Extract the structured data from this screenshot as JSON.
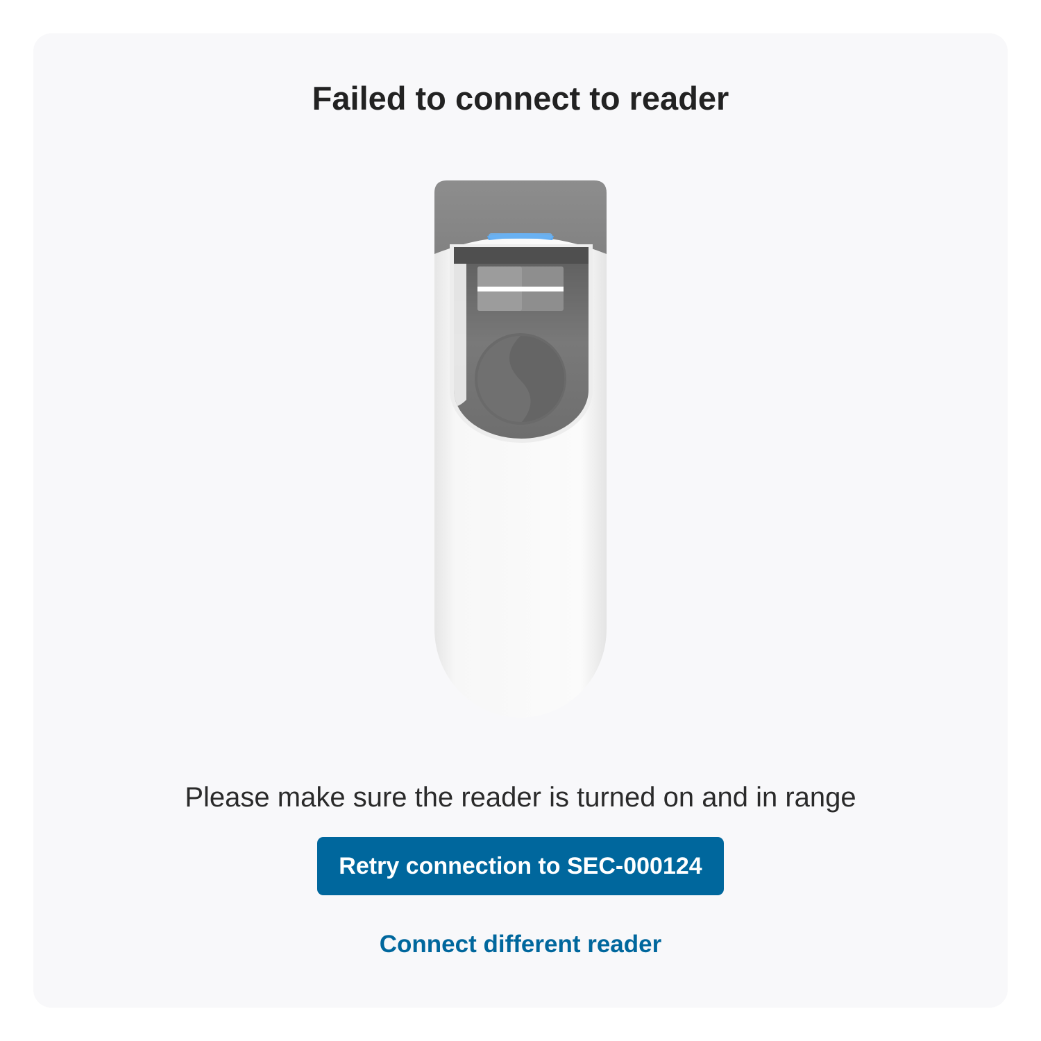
{
  "dialog": {
    "title": "Failed to connect to reader",
    "message": "Please make sure the reader is turned on and in range",
    "retry_label": "Retry connection to SEC-000124",
    "alternate_label": "Connect different reader"
  },
  "device": {
    "icon": "card-reader-icon",
    "status_light": "blue"
  },
  "colors": {
    "accent": "#00679d",
    "card_background": "#f8f8fa",
    "status_light": "#5aa7ef"
  }
}
